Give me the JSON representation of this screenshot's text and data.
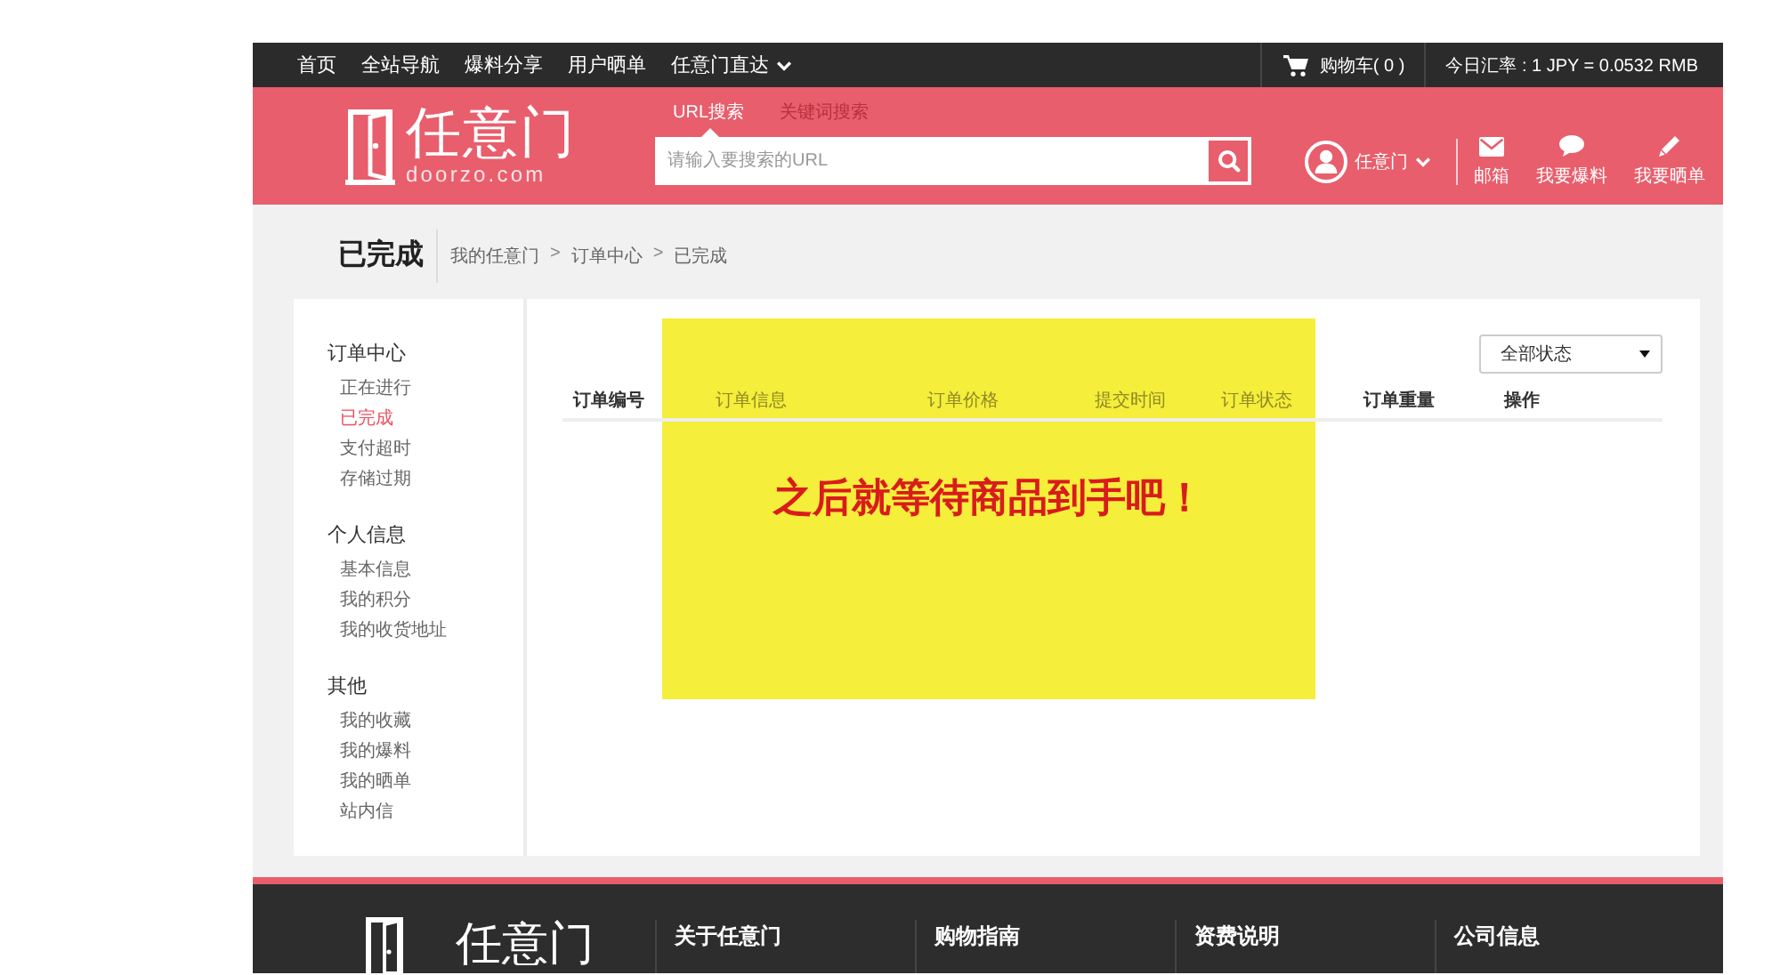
{
  "top_bar": {
    "nav": [
      {
        "label": "首页",
        "dropdown": false
      },
      {
        "label": "全站导航",
        "dropdown": false
      },
      {
        "label": "爆料分享",
        "dropdown": false
      },
      {
        "label": "用户晒单",
        "dropdown": false
      },
      {
        "label": "任意门直达",
        "dropdown": true
      }
    ],
    "cart": "购物车( 0 )",
    "exchange_rate": "今日汇率 : 1 JPY = 0.0532 RMB"
  },
  "header": {
    "logo": {
      "name": "任意门",
      "domain": "doorzo.com"
    },
    "search": {
      "tabs": [
        {
          "label": "URL搜索",
          "selected": true
        },
        {
          "label": "关键词搜索",
          "selected": false
        }
      ],
      "placeholder": "请输入要搜索的URL"
    },
    "user": {
      "name": "任意门"
    },
    "actions": [
      {
        "kind": "mail",
        "label": "邮箱"
      },
      {
        "kind": "comment",
        "label": "我要爆料"
      },
      {
        "kind": "pencil",
        "label": "我要晒单"
      }
    ]
  },
  "page": {
    "title": "已完成",
    "breadcrumb": [
      {
        "label": "我的任意门",
        "separator": ">"
      },
      {
        "label": "订单中心",
        "separator": ">"
      },
      {
        "label": "已完成"
      }
    ]
  },
  "sidebar": {
    "groups": [
      {
        "title": "订单中心",
        "items": [
          {
            "label": "正在进行",
            "selected": false
          },
          {
            "label": "已完成",
            "selected": true
          },
          {
            "label": "支付超时",
            "selected": false
          },
          {
            "label": "存储过期",
            "selected": false
          }
        ]
      },
      {
        "title": "个人信息",
        "items": [
          {
            "label": "基本信息",
            "selected": false
          },
          {
            "label": "我的积分",
            "selected": false
          },
          {
            "label": "我的收货地址",
            "selected": false
          }
        ]
      },
      {
        "title": "其他",
        "items": [
          {
            "label": "我的收藏",
            "selected": false
          },
          {
            "label": "我的爆料",
            "selected": false
          },
          {
            "label": "我的晒单",
            "selected": false
          },
          {
            "label": "站内信",
            "selected": false
          }
        ]
      }
    ]
  },
  "orders": {
    "status_filter": "全部状态",
    "table": {
      "columns": [
        "订单编号",
        "订单信息",
        "订单价格",
        "提交时间",
        "订单状态",
        "订单重量",
        "操作"
      ]
    }
  },
  "annotation": {
    "text": "之后就等待商品到手吧！"
  },
  "footer": {
    "logo": {
      "name": "任意门"
    },
    "columns": [
      "关于任意门",
      "购物指南",
      "资费说明",
      "公司信息"
    ]
  }
}
